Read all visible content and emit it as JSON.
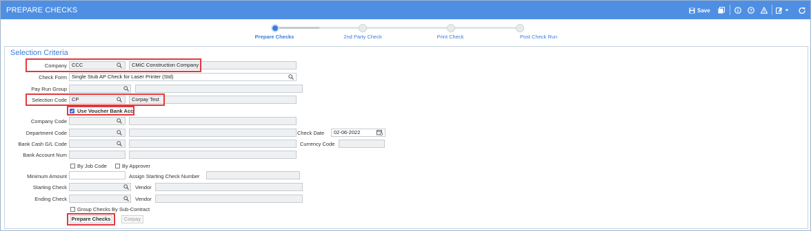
{
  "app": {
    "title": "PREPARE CHECKS"
  },
  "toolbar": {
    "save_label": "Save"
  },
  "steps": [
    {
      "label": "Prepare Checks",
      "active": true
    },
    {
      "label": "2nd Party Check",
      "active": false
    },
    {
      "label": "Print Check",
      "active": false
    },
    {
      "label": "Post Check Run",
      "active": false
    }
  ],
  "section": {
    "title": "Selection Criteria"
  },
  "form": {
    "company": {
      "label": "Company",
      "code": "CCC",
      "name": "CMiC Construction Company"
    },
    "check_form": {
      "label": "Check Form",
      "value": "Single Stub AP Check for Laser Printer (Std)"
    },
    "pay_run_group": {
      "label": "Pay Run Group",
      "value": ""
    },
    "selection_code": {
      "label": "Selection Code",
      "code": "CP",
      "name": "Corpay Test"
    },
    "use_voucher_bank_acc": {
      "label": "Use Voucher Bank Acc",
      "checked": true
    },
    "company_code": {
      "label": "Company Code"
    },
    "department_code": {
      "label": "Department Code"
    },
    "check_date": {
      "label": "Check Date",
      "value": "02-06-2022"
    },
    "bank_cash_gl_code": {
      "label": "Bank Cash G/L Code"
    },
    "currency_code": {
      "label": "Currency Code"
    },
    "bank_account_num": {
      "label": "Bank Account Num"
    },
    "by_job_code": {
      "label": "By Job Code",
      "checked": false
    },
    "by_approver": {
      "label": "By Approver",
      "checked": false
    },
    "minimum_amount": {
      "label": "Minimum Amount"
    },
    "assign_starting_check_number": {
      "label": "Assign Starting Check Number"
    },
    "starting_check": {
      "label": "Starting Check"
    },
    "starting_vendor": {
      "label": "Vendor"
    },
    "ending_check": {
      "label": "Ending Check"
    },
    "ending_vendor": {
      "label": "Vendor"
    },
    "group_checks_by_sub_contract": {
      "label": "Group Checks By Sub-Contract",
      "checked": false
    }
  },
  "buttons": {
    "prepare_checks": "Prepare Checks",
    "corpay": "Corpay"
  },
  "colors": {
    "titlebar": "#4f8fe3",
    "accent": "#3b7dd8",
    "highlight": "#e3383b"
  }
}
